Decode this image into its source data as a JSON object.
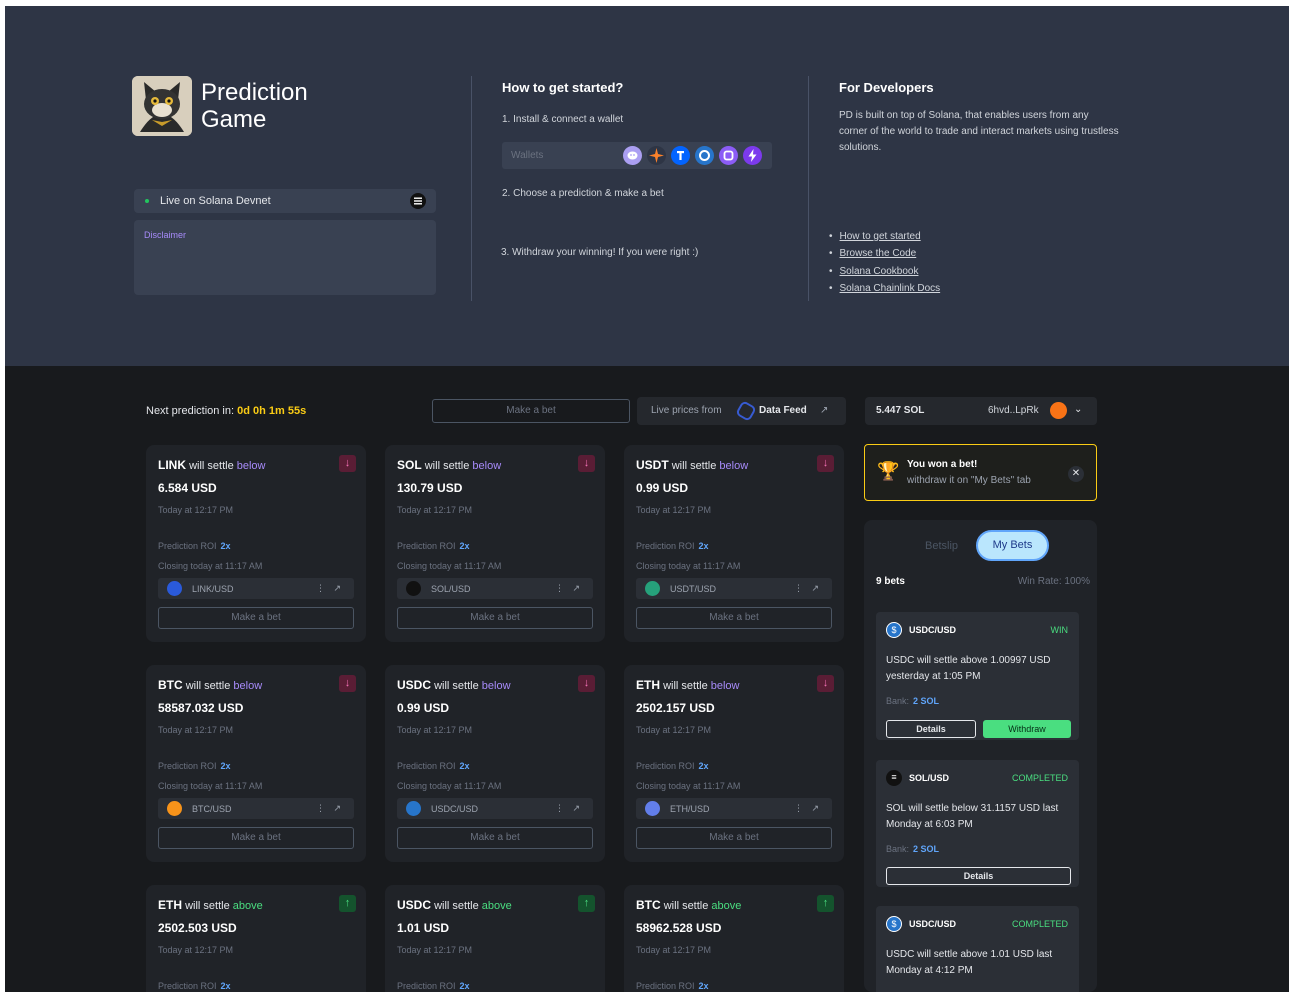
{
  "brand": {
    "line1": "Prediction",
    "line2": "Game"
  },
  "status": {
    "label": "Live on Solana Devnet",
    "disclaimer": "Disclaimer"
  },
  "get_started": {
    "title": "How to get started?",
    "step1": "1. Install & connect a wallet",
    "wallets_label": "Wallets",
    "wallet_icons": [
      "phantom-icon",
      "solflare-icon",
      "torus-icon",
      "coin98-icon",
      "slope-icon",
      "glow-icon"
    ],
    "step2": "2. Choose a prediction & make a bet",
    "step3": "3. Withdraw your winning! If you were right :)"
  },
  "developers": {
    "title": "For Developers",
    "text": "PD is built on top of Solana, that enables users from any corner of the world to trade and interact markets using trustless solutions.",
    "links": [
      "How to get started",
      "Browse the Code",
      "Solana Cookbook",
      "Solana Chainlink Docs"
    ]
  },
  "toolbar": {
    "next_prediction_label": "Next prediction in:",
    "countdown": "0d 0h 1m 55s",
    "make_bet": "Make a bet",
    "live_prices": "Live prices from",
    "data_feed": "Data Feed",
    "balance": "5.447 SOL",
    "address": "6hvd..LpRk"
  },
  "cards": [
    {
      "asset": "LINK",
      "direction": "below",
      "price": "6.584 USD",
      "time": "Today at 12:17 PM",
      "roi": "2x",
      "closing": "Closing today at 11:17 AM",
      "pair": "LINK/USD",
      "icon_color": "#2a5ada"
    },
    {
      "asset": "SOL",
      "direction": "below",
      "price": "130.79 USD",
      "time": "Today at 12:17 PM",
      "roi": "2x",
      "closing": "Closing today at 11:17 AM",
      "pair": "SOL/USD",
      "icon_color": "#111111"
    },
    {
      "asset": "USDT",
      "direction": "below",
      "price": "0.99 USD",
      "time": "Today at 12:17 PM",
      "roi": "2x",
      "closing": "Closing today at 11:17 AM",
      "pair": "USDT/USD",
      "icon_color": "#26a17b"
    },
    {
      "asset": "BTC",
      "direction": "below",
      "price": "58587.032 USD",
      "time": "Today at 12:17 PM",
      "roi": "2x",
      "closing": "Closing today at 11:17 AM",
      "pair": "BTC/USD",
      "icon_color": "#f7931a"
    },
    {
      "asset": "USDC",
      "direction": "below",
      "price": "0.99 USD",
      "time": "Today at 12:17 PM",
      "roi": "2x",
      "closing": "Closing today at 11:17 AM",
      "pair": "USDC/USD",
      "icon_color": "#2775ca"
    },
    {
      "asset": "ETH",
      "direction": "below",
      "price": "2502.157 USD",
      "time": "Today at 12:17 PM",
      "roi": "2x",
      "closing": "Closing today at 11:17 AM",
      "pair": "ETH/USD",
      "icon_color": "#627eea"
    },
    {
      "asset": "ETH",
      "direction": "above",
      "price": "2502.503 USD",
      "time": "Today at 12:17 PM",
      "roi": "2x",
      "closing": "",
      "pair": "",
      "icon_color": "#627eea"
    },
    {
      "asset": "USDC",
      "direction": "above",
      "price": "1.01 USD",
      "time": "Today at 12:17 PM",
      "roi": "2x",
      "closing": "",
      "pair": "",
      "icon_color": "#2775ca"
    },
    {
      "asset": "BTC",
      "direction": "above",
      "price": "58962.528 USD",
      "time": "Today at 12:17 PM",
      "roi": "2x",
      "closing": "",
      "pair": "",
      "icon_color": "#f7931a"
    }
  ],
  "card_text": {
    "will_settle": "will settle",
    "roi_label": "Prediction ROI",
    "make_bet": "Make a bet"
  },
  "toast": {
    "title": "You won a bet!",
    "subtitle": "withdraw it on \"My Bets\" tab"
  },
  "bets_panel": {
    "tab_betslip": "Betslip",
    "tab_mybets": "My Bets",
    "count": "9 bets",
    "win_rate": "Win Rate: 100%",
    "bank_label": "Bank:",
    "details": "Details",
    "withdraw": "Withdraw",
    "items": [
      {
        "pair": "USDC/USD",
        "status": "WIN",
        "desc": "USDC will settle above 1.00997 USD yesterday at 1:05 PM",
        "bank": "2 SOL",
        "icon_color": "#2775ca"
      },
      {
        "pair": "SOL/USD",
        "status": "COMPLETED",
        "desc": "SOL will settle below 31.1157 USD last Monday at 6:03 PM",
        "bank": "2 SOL",
        "icon_color": "#111111"
      },
      {
        "pair": "USDC/USD",
        "status": "COMPLETED",
        "desc": "USDC will settle above 1.01 USD last Monday at 4:12 PM",
        "bank": "",
        "icon_color": "#2775ca"
      }
    ]
  }
}
